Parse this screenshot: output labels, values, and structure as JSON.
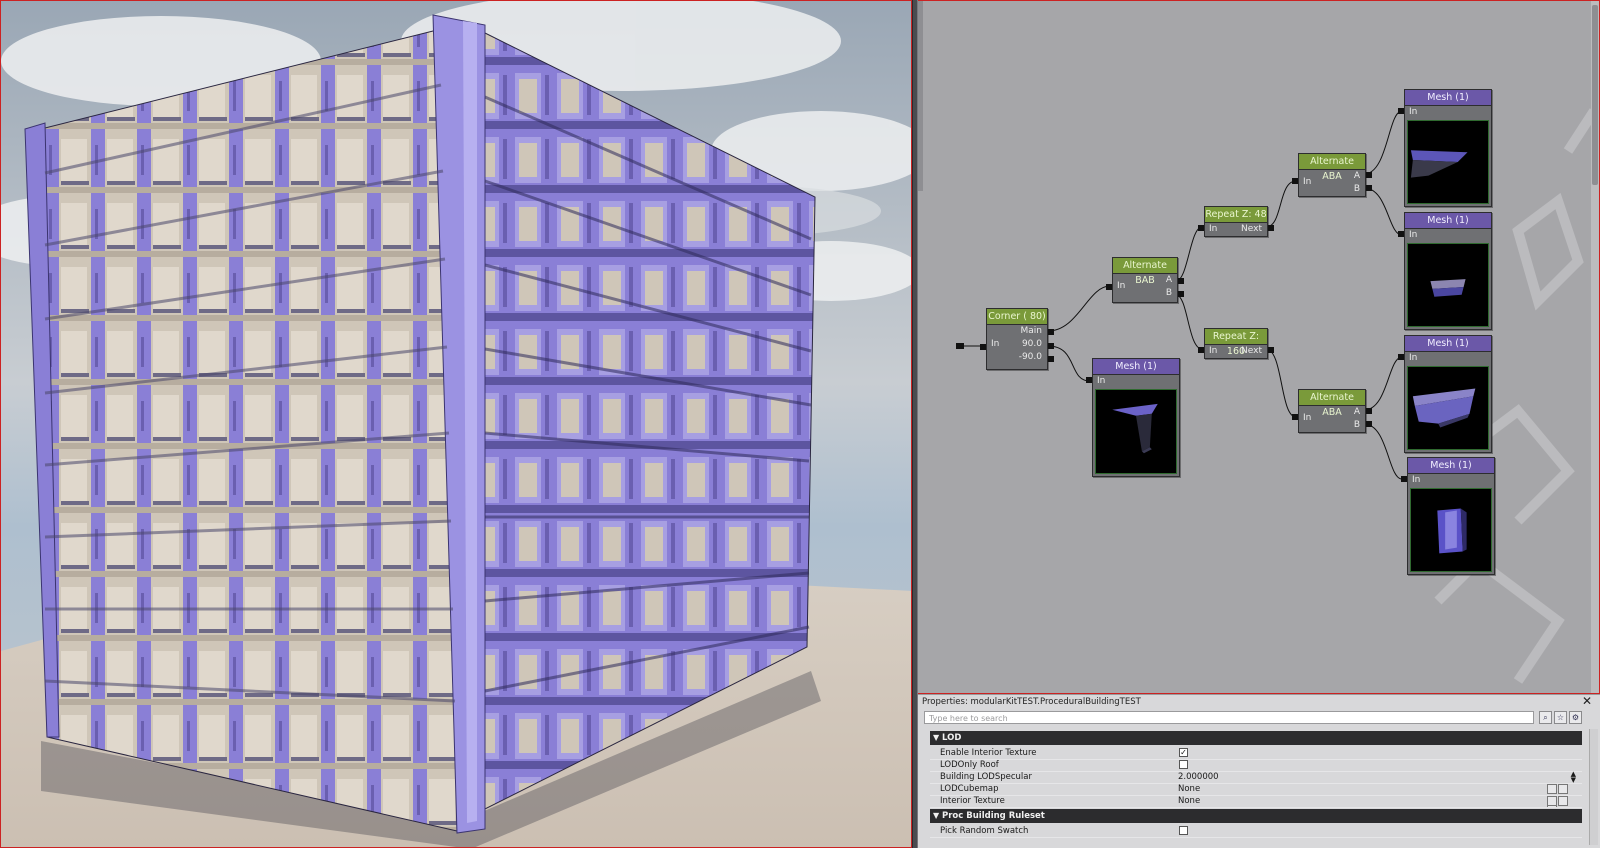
{
  "graph": {
    "nodes": {
      "corner": {
        "title": "Corner ( 80)",
        "in_label": "In",
        "out_main": "Main",
        "out_pos": "90.0",
        "out_neg": "-90.0"
      },
      "alt_bab": {
        "title": "Alternate BAB",
        "in_label": "In",
        "out_a": "A",
        "out_b": "B"
      },
      "repeat48": {
        "title": "Repeat Z: 48",
        "in_label": "In",
        "out_next": "Next"
      },
      "repeat160": {
        "title": "Repeat Z: 160",
        "in_label": "In",
        "out_next": "Next"
      },
      "alt_aba_top": {
        "title": "Alternate ABA",
        "in_label": "In",
        "out_a": "A",
        "out_b": "B"
      },
      "alt_aba_bottom": {
        "title": "Alternate ABA",
        "in_label": "In",
        "out_a": "A",
        "out_b": "B"
      },
      "mesh_center": {
        "title": "Mesh (1)",
        "in_label": "In"
      },
      "mesh_r1": {
        "title": "Mesh (1)",
        "in_label": "In"
      },
      "mesh_r2": {
        "title": "Mesh (1)",
        "in_label": "In"
      },
      "mesh_r3": {
        "title": "Mesh (1)",
        "in_label": "In"
      },
      "mesh_r4": {
        "title": "Mesh (1)",
        "in_label": "In"
      }
    }
  },
  "properties": {
    "title": "Properties: modularKitTEST.ProceduralBuildingTEST",
    "close_glyph": "✕",
    "search_placeholder": "Type here to search",
    "categories": [
      {
        "name": "LOD"
      },
      {
        "name": "Proc Building Ruleset"
      }
    ],
    "lod_rows": [
      {
        "label": "Enable Interior Texture",
        "checked": true
      },
      {
        "label": "LODOnly Roof",
        "checked": false
      },
      {
        "label": "Building LODSpecular",
        "value": "2.000000"
      },
      {
        "label": "LODCubemap",
        "value": "None"
      },
      {
        "label": "Interior Texture",
        "value": "None"
      }
    ],
    "ruleset_rows": [
      {
        "label": "Pick Random Swatch",
        "checked": false
      }
    ],
    "check_glyph": "✓"
  },
  "colors": {
    "node_green": "#7a9a3a",
    "node_purple": "#6b58a8",
    "graph_bg": "#a6a6a9",
    "building_purple": "#8a7fd6",
    "building_cream": "#cfc6b8"
  }
}
